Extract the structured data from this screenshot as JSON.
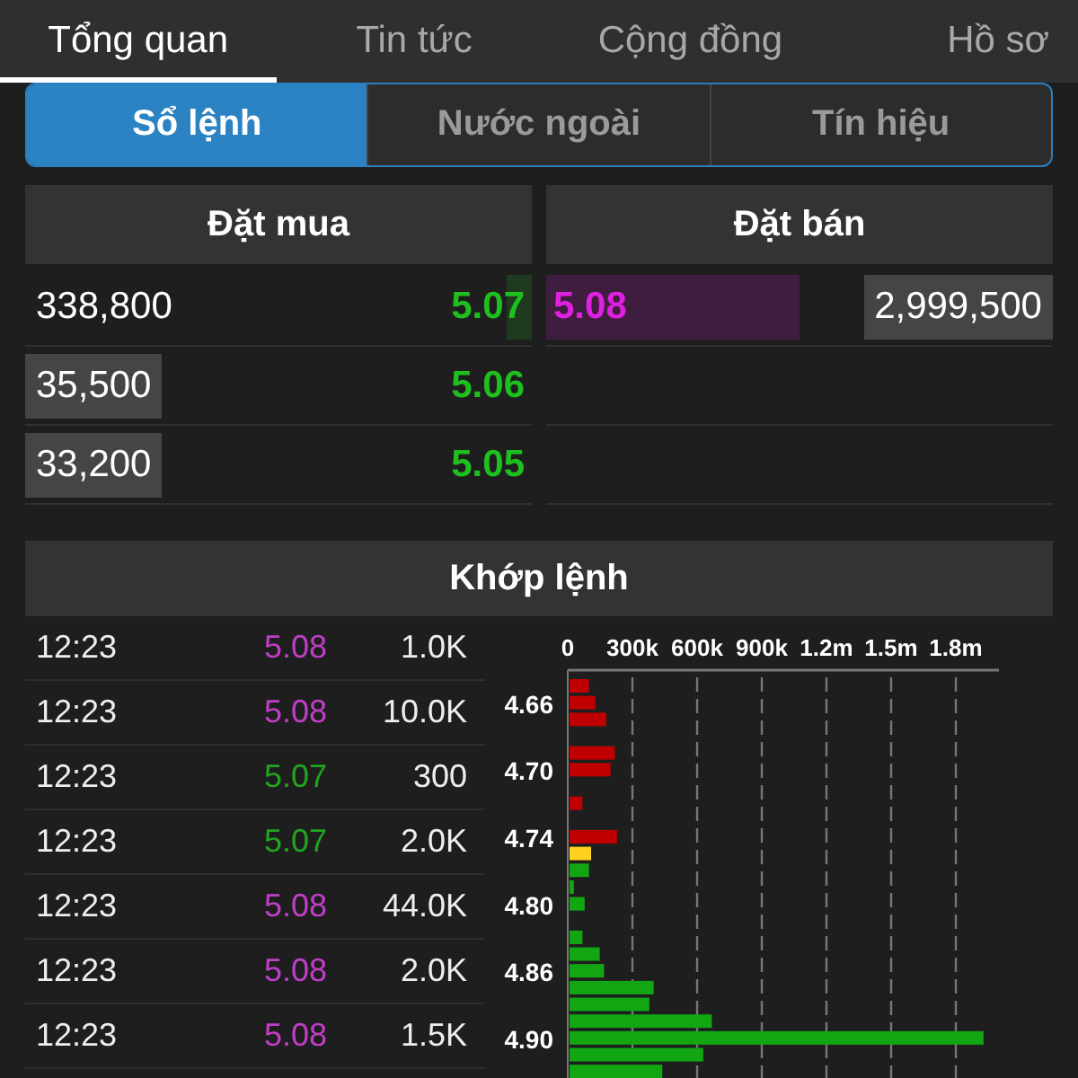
{
  "tabs": [
    {
      "label": "Tổng quan",
      "selected": true
    },
    {
      "label": "Tin tức",
      "selected": false
    },
    {
      "label": "Cộng đồng",
      "selected": false
    },
    {
      "label": "Hồ sơ",
      "selected": false
    }
  ],
  "segments": [
    {
      "label": "Sổ lệnh",
      "selected": true
    },
    {
      "label": "Nước ngoài",
      "selected": false
    },
    {
      "label": "Tín hiệu",
      "selected": false
    }
  ],
  "order_book": {
    "buy_title": "Đặt mua",
    "sell_title": "Đặt bán",
    "buy": [
      {
        "volume": "338,800",
        "volume_highlight": false,
        "price": "5.07",
        "level": 0.05
      },
      {
        "volume": "35,500",
        "volume_highlight": true,
        "price": "5.06"
      },
      {
        "volume": "33,200",
        "volume_highlight": true,
        "price": "5.05"
      }
    ],
    "sell": [
      {
        "price": "5.08",
        "volume": "2,999,500",
        "volume_highlight": true,
        "level": 0.5
      }
    ]
  },
  "matched": {
    "title": "Khớp lệnh",
    "rows": [
      {
        "time": "12:23",
        "price": "5.08",
        "kind": "sell",
        "volume": "1.0K"
      },
      {
        "time": "12:23",
        "price": "5.08",
        "kind": "sell",
        "volume": "10.0K"
      },
      {
        "time": "12:23",
        "price": "5.07",
        "kind": "buy",
        "volume": "300"
      },
      {
        "time": "12:23",
        "price": "5.07",
        "kind": "buy",
        "volume": "2.0K"
      },
      {
        "time": "12:23",
        "price": "5.08",
        "kind": "sell",
        "volume": "44.0K"
      },
      {
        "time": "12:23",
        "price": "5.08",
        "kind": "sell",
        "volume": "2.0K"
      },
      {
        "time": "12:23",
        "price": "5.08",
        "kind": "sell",
        "volume": "1.5K"
      }
    ],
    "chart_data": {
      "type": "bar",
      "orientation": "horizontal",
      "categories": [
        null,
        "4.66",
        null,
        null,
        null,
        "4.70",
        null,
        null,
        null,
        "4.74",
        null,
        null,
        null,
        "4.80",
        null,
        null,
        null,
        "4.86",
        null,
        null,
        null,
        "4.90",
        null,
        null
      ],
      "series": [
        {
          "color": "#c00000",
          "values": [
            90000,
            120000,
            170000,
            0,
            210000,
            190000,
            0,
            60000,
            0,
            220000,
            null,
            null,
            null,
            null,
            null,
            null,
            null,
            null,
            null,
            null,
            null,
            null,
            null,
            null
          ]
        },
        {
          "color": "#ffd21f",
          "values": [
            null,
            null,
            null,
            null,
            null,
            null,
            null,
            null,
            null,
            null,
            100000,
            null,
            null,
            null,
            null,
            null,
            null,
            null,
            null,
            null,
            null,
            null,
            null,
            null
          ]
        },
        {
          "color": "#12a712",
          "values": [
            null,
            null,
            null,
            null,
            null,
            null,
            null,
            null,
            null,
            null,
            null,
            90000,
            20000,
            70000,
            0,
            60000,
            140000,
            160000,
            390000,
            370000,
            660000,
            1920000,
            620000,
            430000
          ]
        }
      ],
      "grid": true,
      "xlim": [
        0,
        2000000
      ],
      "xticks": [
        {
          "value": 0,
          "label": "0"
        },
        {
          "value": 300000,
          "label": "300k"
        },
        {
          "value": 600000,
          "label": "600k"
        },
        {
          "value": 900000,
          "label": "900k"
        },
        {
          "value": 1200000,
          "label": "1.2m"
        },
        {
          "value": 1500000,
          "label": "1.5m"
        },
        {
          "value": 1800000,
          "label": "1.8m"
        }
      ]
    }
  }
}
